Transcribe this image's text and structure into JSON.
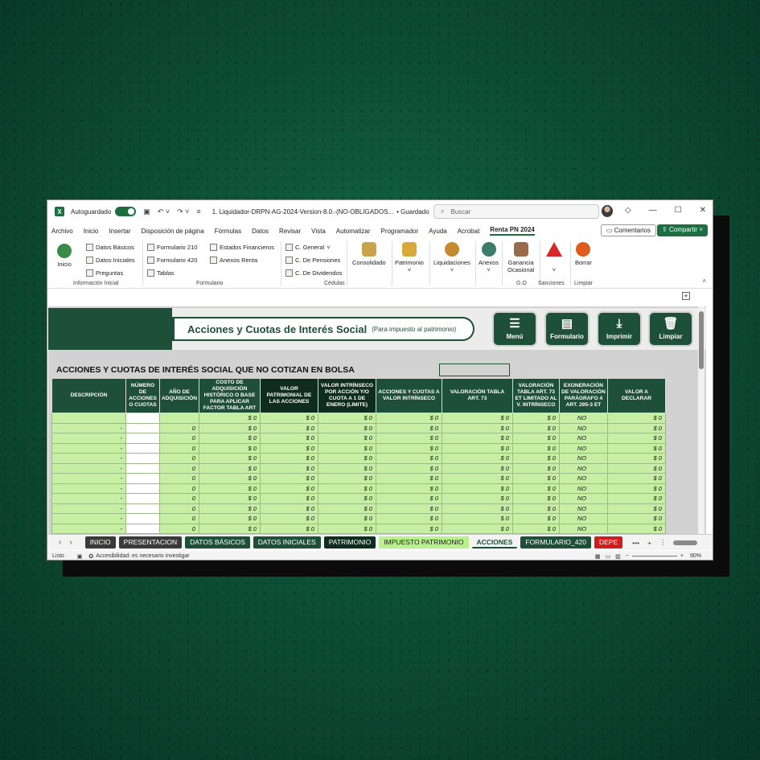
{
  "titlebar": {
    "autosave_label": "Autoguardado",
    "doc_title": "1. Liquidador-DRPN-AG-2024-Version-8.0.-(NO-OBLIGADOS...",
    "saved_state": "• Guardado",
    "search_placeholder": "Buscar"
  },
  "menu": {
    "items": [
      "Archivo",
      "Inicio",
      "Insertar",
      "Disposición de página",
      "Fórmulas",
      "Datos",
      "Revisar",
      "Vista",
      "Automatizar",
      "Programador",
      "Ayuda",
      "Acrobat",
      "Renta PN 2024"
    ],
    "comments_label": "Comentarios",
    "share_label": "Compartir"
  },
  "ribbon": {
    "inicio": "Inicio",
    "datos_basicos": "Datos Básicos",
    "datos_iniciales": "Datos Iniciales",
    "preguntas": "Preguntas",
    "group_info": "Información Inicial",
    "formulario_210": "Formulario 210",
    "formulario_420": "Formulario 420",
    "tablas": "Tablas",
    "estados_financieros": "Estados Financieros",
    "anexos_renta": "Anexos Renta",
    "group_formulario": "Formulario",
    "c_general": "C. General",
    "c_pensiones": "C. De Pensiones",
    "c_dividendos": "C. De Dividendos",
    "group_cedulas": "Cédulas",
    "consolidado": "Consolidado",
    "patrimonio": "Patrimonio",
    "liquidaciones": "Liquidaciones",
    "anexos": "Anexos",
    "ganancia_line1": "Ganancia",
    "ganancia_line2": "Ocasional",
    "group_go": "G.O",
    "sanciones": "Sanciones",
    "borrar": "Borrar",
    "group_limpiar": "Limpiar"
  },
  "sheet": {
    "title": "Acciones y Cuotas de Interés Social",
    "subtitle": "(Para impuesto al patrimonio)",
    "nav": {
      "menu": "Menú",
      "formulario": "Formulario",
      "imprimir": "Imprimir",
      "limpiar": "Limpiar"
    },
    "section_title": "ACCIONES Y CUOTAS DE INTERÉS SOCIAL QUE NO COTIZAN EN BOLSA",
    "headers": [
      "DESCRIPCIÓN",
      "NÚMERO DE ACCIONES O CUOTAS",
      "AÑO DE ADQUISICIÓN",
      "COSTO DE ADQUISICIÓN HISTÓRICO O BASE PARA APLICAR FACTOR TABLA ART",
      "VALOR PATRIMONIAL DE LAS ACCIONES",
      "VALOR INTRÍNSECO POR ACCIÓN Y/O CUOTA A 1 DE ENERO (LIMITE)",
      "ACCIONES Y CUOTAS A VALOR INTRÍNSECO",
      "VALORACIÓN TABLA ART. 73",
      "VALORACIÓN TABLA ART. 73 ET LIMITADO AL V. INTRÍNSECO",
      "EXONERACIÓN DE VALORACIÓN PARÁGRAFO 4 ART. 295-3 ET",
      "VALOR A DECLARAR"
    ],
    "rows": [
      [
        "",
        "",
        "",
        "$ 0",
        "$ 0",
        "$ 0",
        "$ 0",
        "$ 0",
        "$ 0",
        "NO",
        "$ 0"
      ],
      [
        "-",
        "",
        "0",
        "$ 0",
        "$ 0",
        "$ 0",
        "$ 0",
        "$ 0",
        "$ 0",
        "NO",
        "$ 0"
      ],
      [
        "-",
        "",
        "0",
        "$ 0",
        "$ 0",
        "$ 0",
        "$ 0",
        "$ 0",
        "$ 0",
        "NO",
        "$ 0"
      ],
      [
        "-",
        "",
        "0",
        "$ 0",
        "$ 0",
        "$ 0",
        "$ 0",
        "$ 0",
        "$ 0",
        "NO",
        "$ 0"
      ],
      [
        "-",
        "",
        "0",
        "$ 0",
        "$ 0",
        "$ 0",
        "$ 0",
        "$ 0",
        "$ 0",
        "NO",
        "$ 0"
      ],
      [
        "-",
        "",
        "0",
        "$ 0",
        "$ 0",
        "$ 0",
        "$ 0",
        "$ 0",
        "$ 0",
        "NO",
        "$ 0"
      ],
      [
        "-",
        "",
        "0",
        "$ 0",
        "$ 0",
        "$ 0",
        "$ 0",
        "$ 0",
        "$ 0",
        "NO",
        "$ 0"
      ],
      [
        "-",
        "",
        "0",
        "$ 0",
        "$ 0",
        "$ 0",
        "$ 0",
        "$ 0",
        "$ 0",
        "NO",
        "$ 0"
      ],
      [
        "-",
        "",
        "0",
        "$ 0",
        "$ 0",
        "$ 0",
        "$ 0",
        "$ 0",
        "$ 0",
        "NO",
        "$ 0"
      ],
      [
        "-",
        "",
        "0",
        "$ 0",
        "$ 0",
        "$ 0",
        "$ 0",
        "$ 0",
        "$ 0",
        "NO",
        "$ 0"
      ],
      [
        "-",
        "",
        "0",
        "$ 0",
        "$ 0",
        "$ 0",
        "$ 0",
        "$ 0",
        "$ 0",
        "NO",
        "$ 0"
      ],
      [
        "-",
        "",
        "0",
        "$ 0",
        "$ 0",
        "$ 0",
        "$ 0",
        "$ 0",
        "$ 0",
        "NO",
        "$ 0"
      ]
    ]
  },
  "tabs": [
    {
      "label": "INICIO",
      "bg": "#3a3a3a",
      "fg": "#ffffff"
    },
    {
      "label": "PRESENTACION",
      "bg": "#3a3a3a",
      "fg": "#ffffff"
    },
    {
      "label": "DATOS BÁSICOS",
      "bg": "#1e4f38",
      "fg": "#ffffff"
    },
    {
      "label": "DATOS INICIALES",
      "bg": "#1e4f38",
      "fg": "#ffffff"
    },
    {
      "label": "PATRIMONIO",
      "bg": "#0f2d1f",
      "fg": "#ffffff"
    },
    {
      "label": "IMPUESTO PATRIMONIO",
      "bg": "#b9f28c",
      "fg": "#1a1a1a"
    },
    {
      "label": "ACCIONES",
      "bg": "#f3f3f3",
      "fg": "#1e4f38"
    },
    {
      "label": "FORMULARIO_420",
      "bg": "#1e4f38",
      "fg": "#ffffff"
    },
    {
      "label": "DEPE",
      "bg": "#d01c1c",
      "fg": "#ffffff"
    }
  ],
  "status": {
    "listo": "Listo",
    "accesibilidad": "Accesibilidad: es necesario investigar",
    "zoom": "90%"
  },
  "colors": {
    "brand_dark": "#1e4f38",
    "header_dark": "#0f2d1f",
    "cell_green": "#c6efa3",
    "excel_green": "#1d6f42"
  }
}
